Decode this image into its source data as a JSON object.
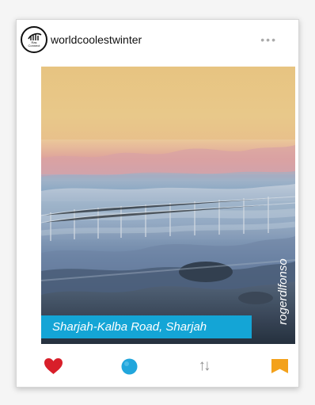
{
  "post": {
    "username": "worldcoolestwinter",
    "more_label": "•••",
    "caption": "Sharjah-Kalba Road, Sharjah",
    "photographer": "rogerdlfonso"
  },
  "avatar": {
    "logo_text": "Ras Connect"
  },
  "actions": {
    "sort_glyph": "↑↓"
  },
  "colors": {
    "caption_bg": "#14a5d6",
    "heart": "#d81f2a",
    "comment": "#21a6dc",
    "bookmark": "#f3a11b",
    "icon_gray": "#8f8f8f"
  },
  "icons": [
    "heart-icon",
    "comment-icon",
    "sort-icon",
    "bookmark-icon",
    "more-icon",
    "brand-logo-icon"
  ]
}
